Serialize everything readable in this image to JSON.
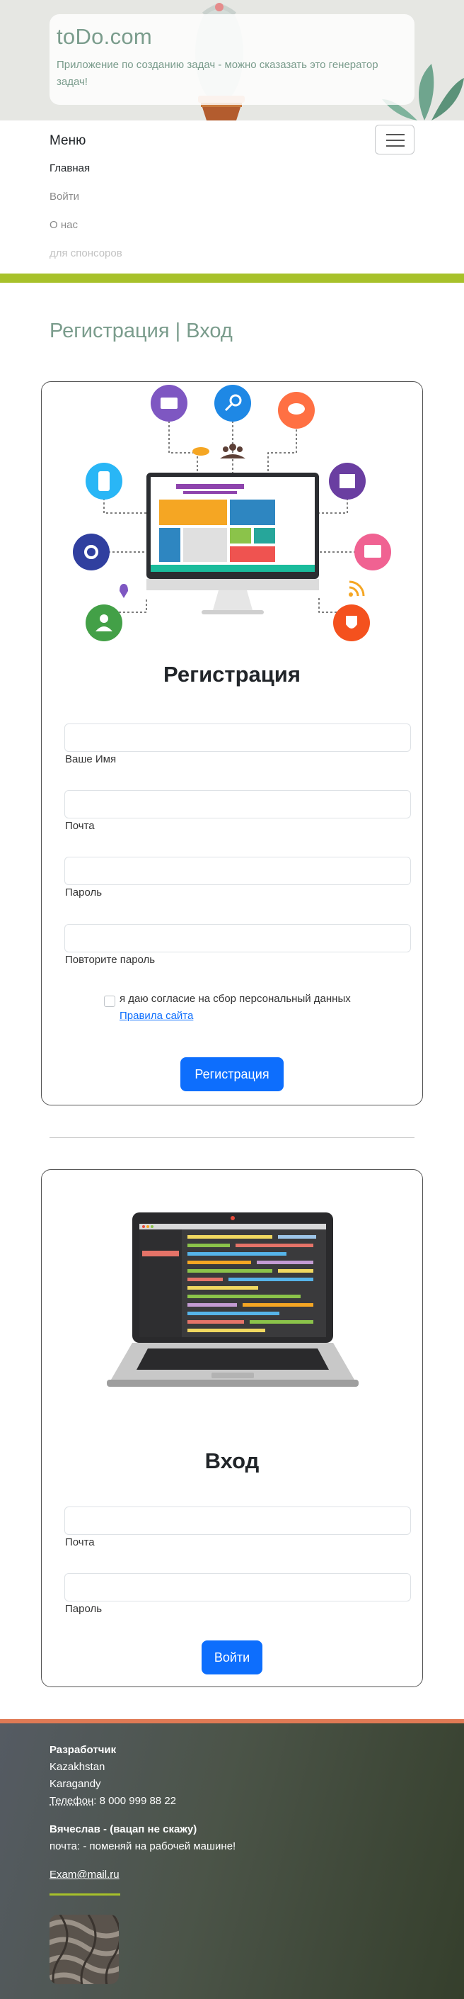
{
  "header": {
    "title": "toDo.com",
    "subtitle": "Приложение по созданию задач - можно сказазать это генератор задач!"
  },
  "nav": {
    "brand": "Меню",
    "items": [
      {
        "label": "Главная"
      },
      {
        "label": "Войти"
      },
      {
        "label": "О нас"
      },
      {
        "label": "для спонсоров"
      }
    ]
  },
  "main": {
    "title": "Регистрация | Вход"
  },
  "register": {
    "heading": "Регистрация",
    "name_label": "Ваше Имя",
    "email_label": "Почта",
    "password_label": "Пароль",
    "repeat_label": "Повторите пароль",
    "consent": "я даю согласие на сбор персональный данных",
    "rules_link": "Правила сайта",
    "submit": "Регистрация"
  },
  "login": {
    "heading": "Вход",
    "email_label": "Почта",
    "password_label": "Пароль",
    "submit": "Войти"
  },
  "footer": {
    "developer_title": "Разработчик",
    "country": "Kazakhstan",
    "city": "Karagandy",
    "phone_label": "Телефон",
    "phone_value": ": 8 000 999 88 22",
    "contact_name": "Вячеслав - (вацап не скажу)",
    "email_note": "почта: - поменяй на рабочей машине!",
    "email": "Exam@mail.ru"
  },
  "colors": {
    "accent_green": "#a7c12a",
    "title_teal": "#7a9c8c",
    "button_blue": "#0d6efd",
    "footer_top_border": "#e07a55"
  }
}
